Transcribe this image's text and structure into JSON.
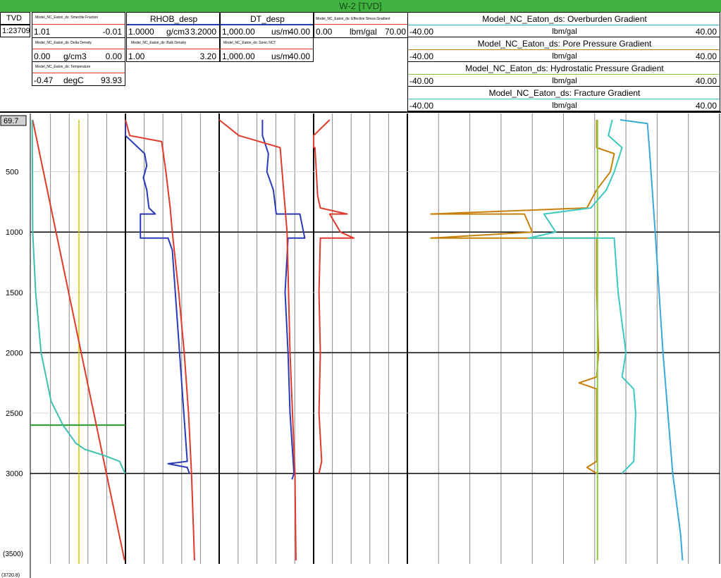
{
  "title": "W-2 [TVD]",
  "depth_track": {
    "label": "TVD",
    "scale": "1:23709",
    "top_depth": "69.7",
    "bottom_marker": "(3500)",
    "last_label": "(3720.8)"
  },
  "track1": {
    "curves": [
      {
        "name": "Model_NC_Eaton_ds: Smectite Fraction",
        "left": "1.01",
        "unit": "",
        "right": "-0.01",
        "color": "#e03a2a"
      },
      {
        "name": "Model_NC_Eaton_ds: Delta Density",
        "left": "0.00",
        "unit": "g/cm3",
        "right": "0.00",
        "color": "#e03a2a"
      },
      {
        "name": "Model_NC_Eaton_ds: Temperature",
        "left": "-0.47",
        "unit": "degC",
        "right": "93.93",
        "color": "#e03a2a"
      }
    ]
  },
  "track2": {
    "curves": [
      {
        "name": "RHOB_desp",
        "left": "1.0000",
        "unit": "g/cm3",
        "right": "3.2000",
        "color": "#2a3ab8"
      },
      {
        "name": "Model_NC_Eaton_ds: Bulk Density",
        "left": "1.00",
        "unit": "",
        "right": "3.20",
        "color": "#e03a2a"
      }
    ]
  },
  "track3": {
    "curves": [
      {
        "name": "DT_desp",
        "left": "1,000.00",
        "unit": "us/m",
        "right": "40.00",
        "color": "#2a3ab8"
      },
      {
        "name": "Model_NC_Eaton_ds: Sonic NCT",
        "left": "1,000.00",
        "unit": "us/m",
        "right": "40.00",
        "color": "#e03a2a"
      }
    ]
  },
  "track4": {
    "curves": [
      {
        "name": "Model_NC_Eaton_ds: Effective Stress Gradient",
        "left": "0.00",
        "unit": "lbm/gal",
        "right": "70.00",
        "color": "#e03a2a"
      }
    ]
  },
  "track5": {
    "curves": [
      {
        "name": "Model_NC_Eaton_ds: Overburden Gradient",
        "left": "-40.00",
        "unit": "lbm/gal",
        "right": "40.00",
        "color": "#3aa8d8"
      },
      {
        "name": "Model_NC_Eaton_ds: Pore Pressure Gradient",
        "left": "-40.00",
        "unit": "lbm/gal",
        "right": "40.00",
        "color": "#c8800a"
      },
      {
        "name": "Model_NC_Eaton_ds: Hydrostatic Pressure Gradient",
        "left": "-40.00",
        "unit": "lbm/gal",
        "right": "40.00",
        "color": "#8cc83a"
      },
      {
        "name": "Model_NC_Eaton_ds: Fracture Gradient",
        "left": "-40.00",
        "unit": "lbm/gal",
        "right": "40.00",
        "color": "#3ac8c0"
      }
    ]
  },
  "chart_data": {
    "type": "line",
    "y_axis": {
      "label": "TVD",
      "range": [
        69.7,
        3720.8
      ],
      "reversed": true,
      "ticks": [
        500,
        1000,
        1500,
        2000,
        2500,
        3000
      ]
    },
    "marker_depth": 2600,
    "series": [
      {
        "name": "Model_NC_Eaton_ds: Smectite Fraction",
        "track": 1,
        "xlim": [
          1.01,
          -0.01
        ],
        "color": "#e03a2a",
        "points": [
          [
            69.7,
            1.0
          ],
          [
            3720.8,
            0.0
          ]
        ]
      },
      {
        "name": "Model_NC_Eaton_ds: Temperature",
        "track": 1,
        "xlim": [
          -0.47,
          93.93
        ],
        "color": "#3cc0b0",
        "points": [
          [
            69.7,
            0
          ],
          [
            1000,
            0.5
          ],
          [
            1500,
            3.5
          ],
          [
            2000,
            9
          ],
          [
            2400,
            19
          ],
          [
            2600,
            31
          ],
          [
            2750,
            44
          ],
          [
            2800,
            53
          ],
          [
            2850,
            72
          ],
          [
            2900,
            88
          ],
          [
            3000,
            93.5
          ]
        ]
      },
      {
        "name": "RHOB_desp",
        "track": 2,
        "xlim": [
          1.0,
          3.2
        ],
        "color": "#2a3ab8",
        "points": [
          [
            69.7,
            1.0
          ],
          [
            200,
            1.0
          ],
          [
            350,
            1.45
          ],
          [
            450,
            1.5
          ],
          [
            550,
            1.42
          ],
          [
            650,
            1.5
          ],
          [
            800,
            1.55
          ],
          [
            850,
            1.7
          ],
          [
            850,
            1.35
          ],
          [
            1050,
            1.35
          ],
          [
            1050,
            2.0
          ],
          [
            1150,
            2.1
          ],
          [
            1500,
            2.17
          ],
          [
            2000,
            2.27
          ],
          [
            2500,
            2.37
          ],
          [
            2900,
            2.45
          ],
          [
            2920,
            2.0
          ],
          [
            2950,
            2.45
          ],
          [
            3000,
            2.5
          ]
        ]
      },
      {
        "name": "Model_NC_Eaton_ds: Bulk Density",
        "track": 2,
        "xlim": [
          1.0,
          3.2
        ],
        "color": "#e03a2a",
        "points": [
          [
            69.7,
            1.0
          ],
          [
            200,
            1.1
          ],
          [
            250,
            1.85
          ],
          [
            500,
            1.95
          ],
          [
            800,
            2.05
          ],
          [
            1000,
            2.1
          ],
          [
            1500,
            2.25
          ],
          [
            2000,
            2.38
          ],
          [
            2500,
            2.48
          ],
          [
            3000,
            2.55
          ],
          [
            3500,
            2.6
          ],
          [
            3720.8,
            2.62
          ]
        ]
      },
      {
        "name": "DT_desp",
        "track": 3,
        "xlim": [
          1000.0,
          40.0
        ],
        "color": "#2a3ab8",
        "points": [
          [
            69.7,
            560
          ],
          [
            200,
            560
          ],
          [
            350,
            500
          ],
          [
            500,
            515
          ],
          [
            650,
            450
          ],
          [
            850,
            420
          ],
          [
            850,
            180
          ],
          [
            1050,
            130
          ],
          [
            1050,
            300
          ],
          [
            1500,
            330
          ],
          [
            2000,
            300
          ],
          [
            2500,
            280
          ],
          [
            3000,
            240
          ],
          [
            3050,
            260
          ]
        ]
      },
      {
        "name": "Model_NC_Eaton_ds: Sonic NCT",
        "track": 3,
        "xlim": [
          1000.0,
          40.0
        ],
        "color": "#e03a2a",
        "points": [
          [
            69.7,
            1000
          ],
          [
            200,
            800
          ],
          [
            300,
            380
          ],
          [
            1000,
            310
          ],
          [
            2000,
            280
          ],
          [
            3000,
            230
          ],
          [
            3720.8,
            220
          ]
        ]
      },
      {
        "name": "Model_NC_Eaton_ds: Effective Stress Gradient",
        "track": 4,
        "xlim": [
          0.0,
          70.0
        ],
        "color": "#e03a2a",
        "points": [
          [
            69.7,
            12
          ],
          [
            200,
            0
          ],
          [
            300,
            0
          ],
          [
            300,
            1
          ],
          [
            700,
            3
          ],
          [
            800,
            5
          ],
          [
            850,
            25
          ],
          [
            850,
            12
          ],
          [
            1000,
            20
          ],
          [
            1050,
            30
          ],
          [
            1050,
            5
          ],
          [
            1500,
            4
          ],
          [
            2000,
            5
          ],
          [
            2500,
            4
          ],
          [
            2900,
            6
          ],
          [
            3000,
            4
          ]
        ]
      },
      {
        "name": "Model_NC_Eaton_ds: Overburden Gradient",
        "track": 5,
        "xlim": [
          -40.0,
          40.0
        ],
        "color": "#3aa8d8",
        "points": [
          [
            69.7,
            14.5
          ],
          [
            100,
            21.5
          ],
          [
            300,
            22
          ],
          [
            1000,
            23.5
          ],
          [
            2000,
            25.5
          ],
          [
            3000,
            28
          ],
          [
            3500,
            30
          ],
          [
            3720.8,
            30.5
          ]
        ]
      },
      {
        "name": "Model_NC_Eaton_ds: Pore Pressure Gradient",
        "track": 5,
        "xlim": [
          -40.0,
          40.0
        ],
        "color": "#c8800a",
        "points": [
          [
            69.7,
            8.5
          ],
          [
            300,
            8.5
          ],
          [
            350,
            13
          ],
          [
            500,
            12
          ],
          [
            650,
            8.5
          ],
          [
            800,
            6
          ],
          [
            850,
            -34
          ],
          [
            850,
            -10
          ],
          [
            1000,
            -8
          ],
          [
            1050,
            -34
          ],
          [
            1050,
            8.5
          ],
          [
            1500,
            8.5
          ],
          [
            2000,
            9
          ],
          [
            2200,
            8.5
          ],
          [
            2250,
            4
          ],
          [
            2300,
            8.5
          ],
          [
            2900,
            8.5
          ],
          [
            2950,
            6
          ],
          [
            3000,
            8.5
          ]
        ]
      },
      {
        "name": "Model_NC_Eaton_ds: Hydrostatic Pressure Gradient",
        "track": 5,
        "xlim": [
          -40.0,
          40.0
        ],
        "color": "#8cc83a",
        "points": [
          [
            69.7,
            8.7
          ],
          [
            3720.8,
            8.7
          ]
        ]
      },
      {
        "name": "Model_NC_Eaton_ds: Fracture Gradient",
        "track": 5,
        "xlim": [
          -40.0,
          40.0
        ],
        "color": "#3ac8c0",
        "points": [
          [
            69.7,
            12.5
          ],
          [
            200,
            11.5
          ],
          [
            300,
            15
          ],
          [
            500,
            13
          ],
          [
            650,
            11
          ],
          [
            800,
            7
          ],
          [
            850,
            -5
          ],
          [
            1000,
            -2
          ],
          [
            1050,
            -9
          ],
          [
            1050,
            13
          ],
          [
            1500,
            14
          ],
          [
            2000,
            16
          ],
          [
            2200,
            15
          ],
          [
            2300,
            18
          ],
          [
            2500,
            18.5
          ],
          [
            2900,
            18
          ],
          [
            3000,
            15
          ]
        ]
      }
    ]
  }
}
